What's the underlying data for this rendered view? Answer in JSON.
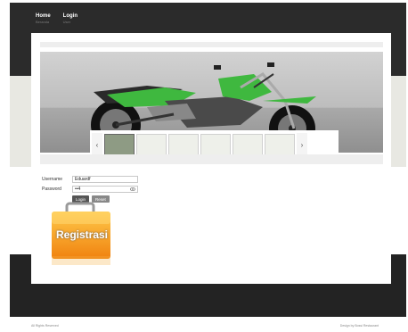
{
  "nav": [
    {
      "title": "Home",
      "subtitle": "Beranda"
    },
    {
      "title": "Login",
      "subtitle": "User"
    }
  ],
  "gallery": {
    "prev_icon": "‹",
    "next_icon": "›",
    "thumbnails": [
      "motorbike-1",
      "motorbike-2",
      "motorbike-3",
      "motorbike-4",
      "motorbike-5",
      "motorbike-6"
    ]
  },
  "login": {
    "username_label": "Username",
    "username_value": "Eduardf",
    "password_label": "Password",
    "password_value": "••4",
    "login_button": "Login",
    "reset_button": "Reset"
  },
  "registration": {
    "label": "Registrasi"
  },
  "footer": {
    "left": "All Rights Reserved",
    "right": "Design by Bossi Restaurant"
  },
  "colors": {
    "header_bg": "#2b2b2b",
    "accent_green": "#3fb83f",
    "badge_orange": "#f29a1c"
  }
}
